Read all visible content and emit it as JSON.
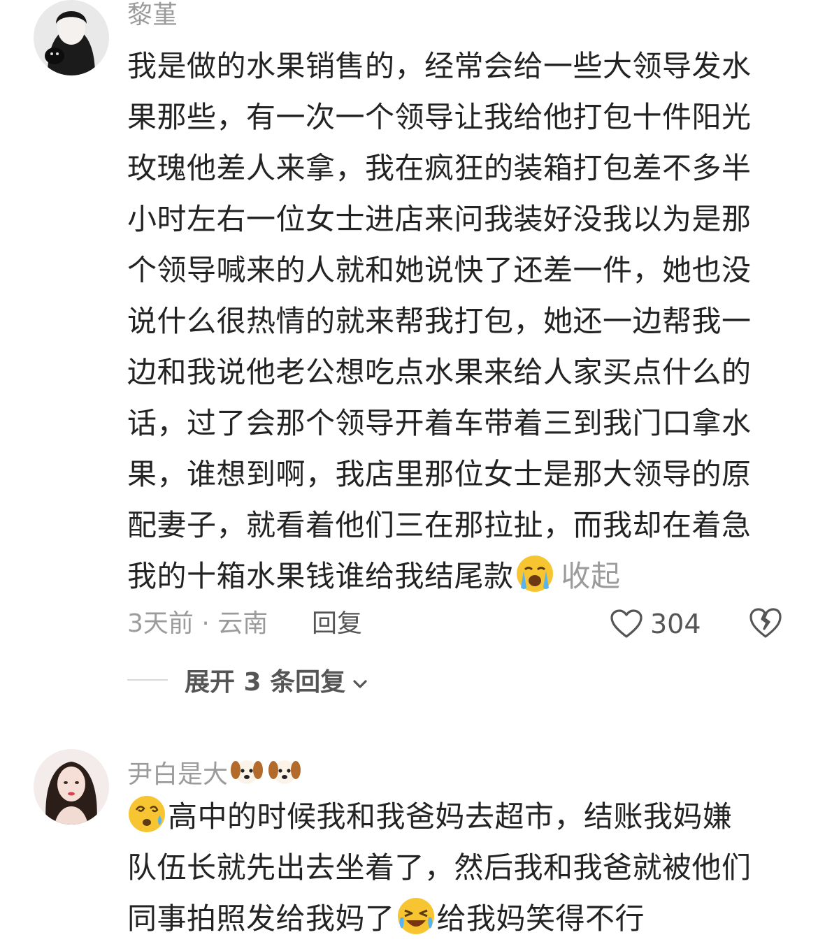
{
  "comments": [
    {
      "username": "黎堇",
      "lines": [
        "我是做的水果销售的，经常会给一些大领导发水",
        "果那些，有一次一个领导让我给他打包十件阳光",
        "玫瑰他差人来拿，我在疯狂的装箱打包差不多半",
        "小时左右一位女士进店来问我装好没我以为是那",
        "个领导喊来的人就和她说快了还差一件，她也没",
        "说什么很热情的就来帮我打包，她还一边帮我一",
        "边和我说他老公想吃点水果来给人家买点什么的",
        "话，过了会那个领导开着车带着三到我门口拿水",
        "果，谁想到啊，我店里那位女士是那大领导的原",
        "配妻子，就看着他们三在那拉扯，而我却在着急",
        "我的十箱水果钱谁给我结尾款"
      ],
      "inline_emoji": "crying-face-emoji",
      "collapse_label": "收起",
      "time_location": "3天前 · 云南",
      "reply_label": "回复",
      "like_count": "304",
      "expand_replies_label": "展开 3 条回复"
    },
    {
      "username": "尹白是大",
      "username_emojis": [
        "dog-face-emoji",
        "dog-face-emoji"
      ],
      "lines": [
        "高中的时候我和我爸妈去超市，结账我妈嫌",
        "队伍长就先出去坐着了，然后我和我爸就被他们",
        "同事拍照发给我妈了",
        "给我妈笑得不行"
      ],
      "leading_emoji": "dizzy-face-emoji",
      "inline_emoji": "laughing-crying-emoji"
    }
  ],
  "colors": {
    "meta_gray": "#9b9b9b",
    "text_dark": "#232323",
    "action_gray": "#555555",
    "emoji_yellow": "#f7c531"
  }
}
